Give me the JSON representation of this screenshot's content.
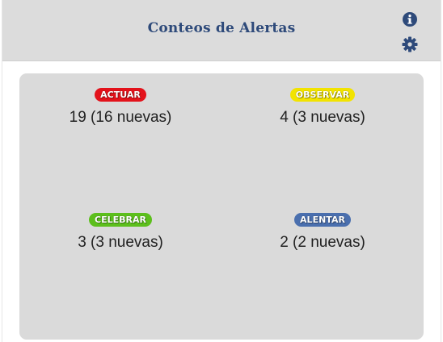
{
  "header": {
    "title": "Conteos de Alertas",
    "info_icon": "info-circle-icon",
    "settings_icon": "gear-icon",
    "icon_color": "#2e4a7a"
  },
  "alerts": [
    {
      "label": "ACTUAR",
      "count": "19 (16 nuevas)",
      "color": "#e3121b"
    },
    {
      "label": "OBSERVAR",
      "count": "4 (3 nuevas)",
      "color": "#f2e300"
    },
    {
      "label": "CELEBRAR",
      "count": "3 (3 nuevas)",
      "color": "#5cbf1c"
    },
    {
      "label": "ALENTAR",
      "count": "2 (2 nuevas)",
      "color": "#4a6fae"
    }
  ]
}
